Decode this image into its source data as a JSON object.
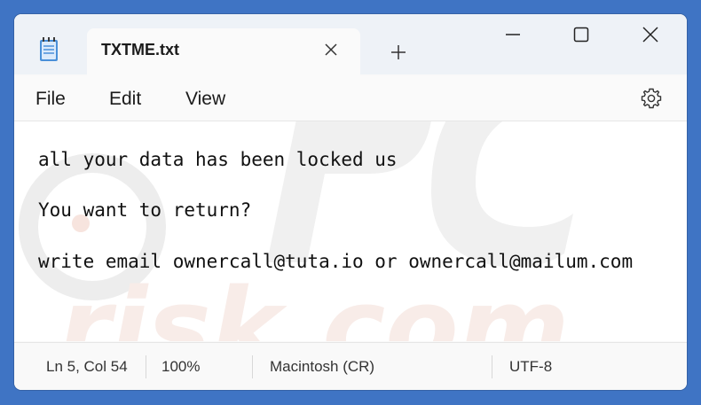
{
  "tab": {
    "title": "TXTME.txt",
    "close_icon": "close-icon",
    "new_tab_icon": "plus-icon"
  },
  "window_controls": {
    "minimize_icon": "minimize-icon",
    "maximize_icon": "maximize-icon",
    "close_icon": "close-icon"
  },
  "menu": {
    "file": "File",
    "edit": "Edit",
    "view": "View",
    "settings_icon": "gear-icon"
  },
  "editor": {
    "lines": [
      "all your data has been locked us",
      "You want to return?",
      "write email ownercall@tuta.io or ownercall@mailum.com"
    ]
  },
  "status": {
    "position": "Ln 5, Col 54",
    "zoom": "100%",
    "line_ending": "Macintosh (CR)",
    "encoding": "UTF-8"
  },
  "colors": {
    "desktop_background": "#3f74c4",
    "titlebar": "#eef2f7",
    "watermark": "#e8e8e8",
    "watermark_accent": "#f6d6cc"
  }
}
